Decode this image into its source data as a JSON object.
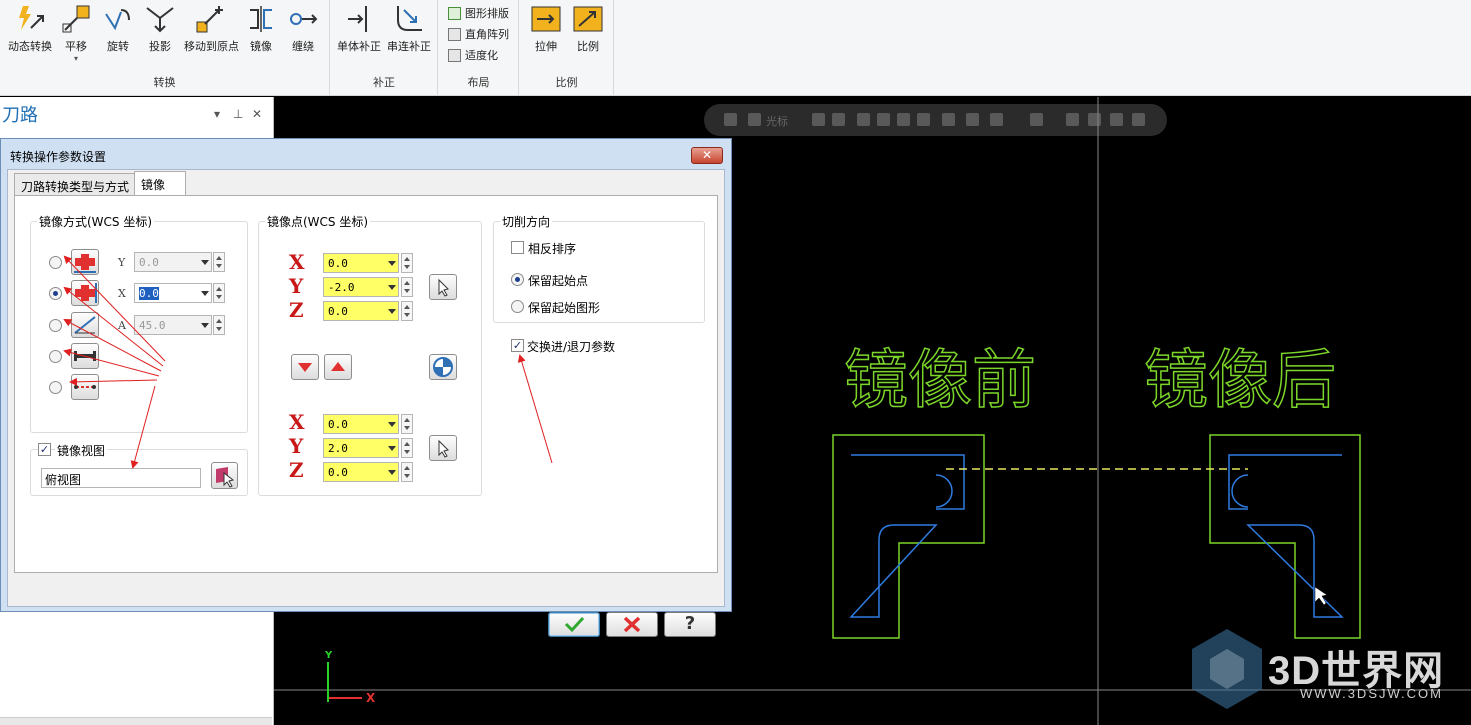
{
  "ribbon": {
    "transform": {
      "label": "转换",
      "buttons": [
        {
          "label": "动态转换",
          "icon": "dynamic-transform-icon"
        },
        {
          "label": "平移",
          "icon": "translate-icon"
        },
        {
          "label": "旋转",
          "icon": "rotate-icon"
        },
        {
          "label": "投影",
          "icon": "project-icon"
        },
        {
          "label": "移动到原点",
          "icon": "move-to-origin-icon"
        },
        {
          "label": "镜像",
          "icon": "mirror-icon"
        },
        {
          "label": "缠绕",
          "icon": "wrap-icon"
        }
      ]
    },
    "compensation": {
      "label": "补正",
      "buttons": [
        {
          "label": "单体补正",
          "icon": "single-offset-icon"
        },
        {
          "label": "串连补正",
          "icon": "chain-offset-icon"
        }
      ]
    },
    "layout": {
      "label": "布局",
      "items": [
        {
          "label": "图形排版",
          "icon": "nesting-icon"
        },
        {
          "label": "直角阵列",
          "icon": "rect-array-icon"
        },
        {
          "label": "适度化",
          "icon": "fit-icon"
        }
      ]
    },
    "scale": {
      "label": "比例",
      "buttons": [
        {
          "label": "拉伸",
          "icon": "stretch-icon"
        },
        {
          "label": "比例",
          "icon": "scale-icon"
        }
      ]
    }
  },
  "left_panel": {
    "title": "刀路"
  },
  "canvas": {
    "toolbar_text": "光标",
    "label_before": "镜像前",
    "label_after": "镜像后",
    "axis_y": "Y",
    "axis_x": "X",
    "colors": {
      "green": "#7cd62a",
      "blue": "#2f7be0",
      "dash": "#e8e860"
    },
    "watermark_main": "3D世界网",
    "watermark_sub": "WWW.3DSJW.COM"
  },
  "dialog": {
    "title": "转换操作参数设置",
    "tabs": [
      {
        "label": "刀路转换类型与方式",
        "active": false
      },
      {
        "label": "镜像",
        "active": true
      }
    ],
    "mirror_method": {
      "title": "镜像方式(WCS 坐标)",
      "options": [
        {
          "axis": "Y",
          "value": "0.0",
          "selected": false,
          "enabled": false
        },
        {
          "axis": "X",
          "value": "0.0",
          "selected": true,
          "enabled": true
        },
        {
          "axis": "A",
          "value": "45.0",
          "selected": false,
          "enabled": false
        },
        {
          "selected": false
        },
        {
          "selected": false
        }
      ]
    },
    "mirror_view": {
      "label": "镜像视图",
      "checked": true,
      "value": "俯视图"
    },
    "mirror_points": {
      "title": "镜像点(WCS 坐标)",
      "point1": [
        {
          "axis": "X",
          "value": "0.0"
        },
        {
          "axis": "Y",
          "value": "-2.0"
        },
        {
          "axis": "Z",
          "value": "0.0"
        }
      ],
      "point2": [
        {
          "axis": "X",
          "value": "0.0"
        },
        {
          "axis": "Y",
          "value": "2.0"
        },
        {
          "axis": "Z",
          "value": "0.0"
        }
      ]
    },
    "cut_direction": {
      "title": "切削方向",
      "reverse_label": "相反排序",
      "reverse_checked": false,
      "keep_start_point_label": "保留起始点",
      "keep_start_point_selected": true,
      "keep_start_geometry_label": "保留起始图形",
      "keep_start_geometry_selected": false
    },
    "swap_entry_exit": {
      "label": "交换进/退刀参数",
      "checked": true
    },
    "footer": {
      "ok": "ok-icon",
      "cancel": "cancel-icon",
      "help": "?"
    }
  }
}
